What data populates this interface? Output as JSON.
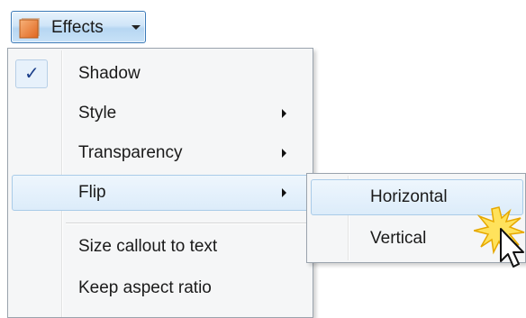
{
  "toolbar": {
    "effects_label": "Effects",
    "effects_icon": "effects-icon"
  },
  "menu": {
    "items": [
      {
        "label": "Shadow",
        "checked": true,
        "has_submenu": false
      },
      {
        "label": "Style",
        "checked": false,
        "has_submenu": true
      },
      {
        "label": "Transparency",
        "checked": false,
        "has_submenu": true
      },
      {
        "label": "Flip",
        "checked": false,
        "has_submenu": true,
        "highlighted": true
      },
      {
        "label": "Size callout to text",
        "checked": false,
        "has_submenu": false
      },
      {
        "label": "Keep aspect ratio",
        "checked": false,
        "has_submenu": false
      }
    ]
  },
  "submenu": {
    "items": [
      {
        "label": "Horizontal",
        "highlighted": true
      },
      {
        "label": "Vertical",
        "highlighted": false
      }
    ]
  },
  "colors": {
    "highlight_border": "#a9cbe8",
    "highlight_fill": "#dcecfa",
    "check_color": "#1b3f8a",
    "burst_color": "#f5c518"
  },
  "icons": {
    "check": "checkmark-icon",
    "submenu_arrow": "submenu-arrow-icon",
    "dropdown_caret": "chevron-down-icon",
    "cursor": "mouse-pointer-icon",
    "click_burst": "click-burst-icon"
  }
}
